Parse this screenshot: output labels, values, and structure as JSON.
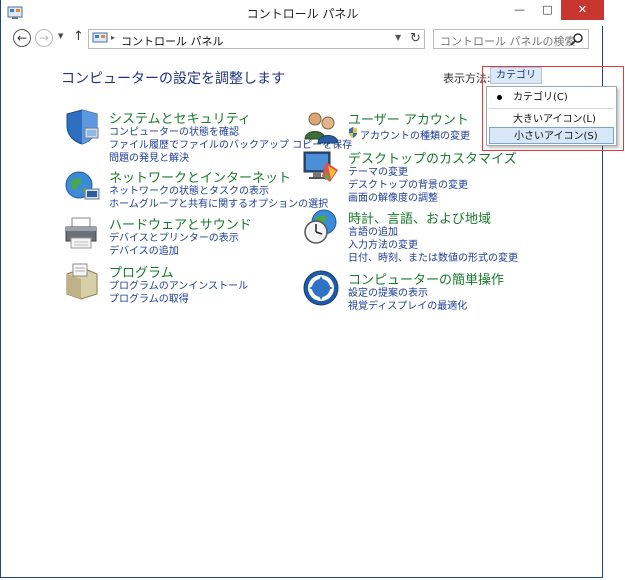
{
  "window": {
    "title": "コントロール パネル",
    "min_label": "—",
    "max_label": "□",
    "close_label": "✕"
  },
  "nav": {
    "back": "←",
    "forward": "→",
    "recent": "▼",
    "up": "↑",
    "address_sep": "▸",
    "address_text": "コントロール パネル",
    "address_dropdown": "▼",
    "refresh": "↻",
    "search_placeholder": "コントロール パネルの検索"
  },
  "main": {
    "heading": "コンピューターの設定を調整します",
    "view_by_label": "表示方法:",
    "view_by_value": "カテゴリ",
    "view_by_arrow": "▾"
  },
  "categories": [
    {
      "title": "システムとセキュリティ",
      "icon": "shield-icon",
      "links": [
        "コンピューターの状態を確認",
        "ファイル履歴でファイルのバックアップ コピーを保存",
        "問題の発見と解決"
      ]
    },
    {
      "title": "ネットワークとインターネット",
      "icon": "network-globe-icon",
      "links": [
        "ネットワークの状態とタスクの表示",
        "ホームグループと共有に関するオプションの選択"
      ]
    },
    {
      "title": "ハードウェアとサウンド",
      "icon": "printer-icon",
      "links": [
        "デバイスとプリンターの表示",
        "デバイスの追加"
      ]
    },
    {
      "title": "プログラム",
      "icon": "programs-box-icon",
      "links": [
        "プログラムのアンインストール",
        "プログラムの取得"
      ]
    },
    {
      "title": "ユーザー アカウント",
      "icon": "users-icon",
      "links": [
        "アカウントの種類の変更"
      ]
    },
    {
      "title": "デスクトップのカスタマイズ",
      "icon": "desktop-monitor-icon",
      "links": [
        "テーマの変更",
        "デスクトップの背景の変更",
        "画面の解像度の調整"
      ]
    },
    {
      "title": "時計、言語、および地域",
      "icon": "clock-globe-icon",
      "links": [
        "言語の追加",
        "入力方法の変更",
        "日付、時刻、または数値の形式の変更"
      ]
    },
    {
      "title": "コンピューターの簡単操作",
      "icon": "ease-of-access-icon",
      "links": [
        "設定の提案の表示",
        "視覚ディスプレイの最適化"
      ]
    }
  ],
  "menu": {
    "items": [
      "カテゴリ(C)",
      "大きいアイコン(L)",
      "小さいアイコン(S)"
    ],
    "checked_index": 0,
    "highlighted_index": 2
  },
  "colors": {
    "category_title": "#1a7b2c",
    "link": "#1e3d99",
    "heading": "#1e3287",
    "close_button": "#c7372f",
    "callout": "#e23b3b"
  }
}
